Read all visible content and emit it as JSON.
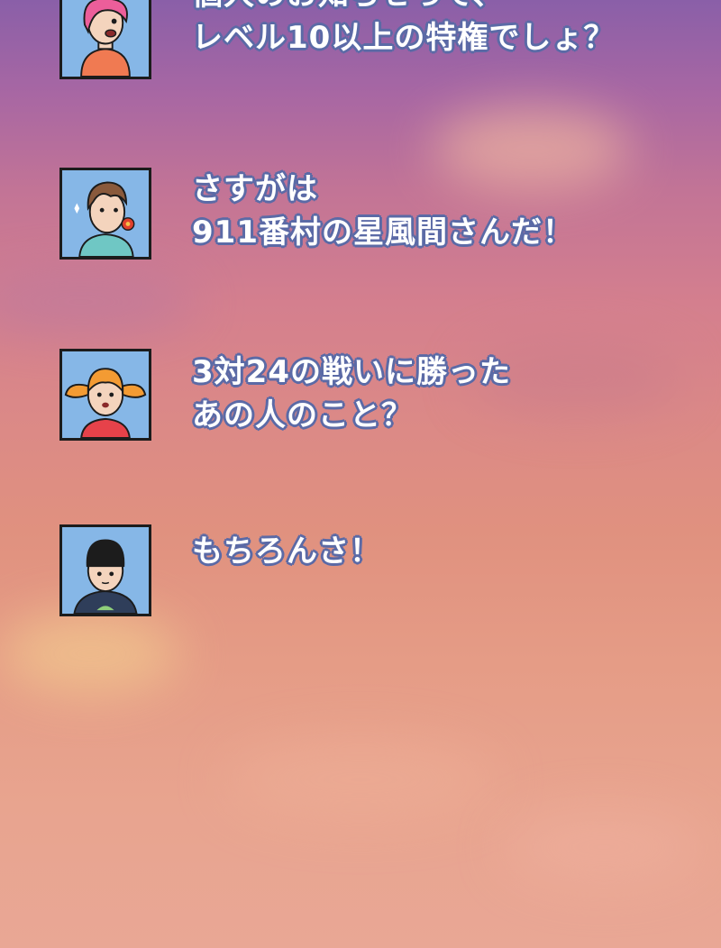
{
  "colors": {
    "text_fill": "#ffffff",
    "text_outline": "#5b6aa6",
    "avatar_bg": "#86b7e7",
    "avatar_border": "#1c1c1c"
  },
  "messages": [
    {
      "speaker_icon": "pink-haired-woman-avatar-icon",
      "lines": [
        "個人のお知らせって、",
        "レベル10以上の特権でしょ？"
      ]
    },
    {
      "speaker_icon": "brown-haired-man-with-flower-avatar-icon",
      "lines": [
        "さすがは",
        "911番村の星風間さんだ！"
      ]
    },
    {
      "speaker_icon": "orange-twintail-girl-avatar-icon",
      "lines": [
        "3対24の戦いに勝った",
        "あの人のこと？"
      ]
    },
    {
      "speaker_icon": "bowl-cut-boy-avatar-icon",
      "lines": [
        "もちろんさ！"
      ]
    }
  ]
}
